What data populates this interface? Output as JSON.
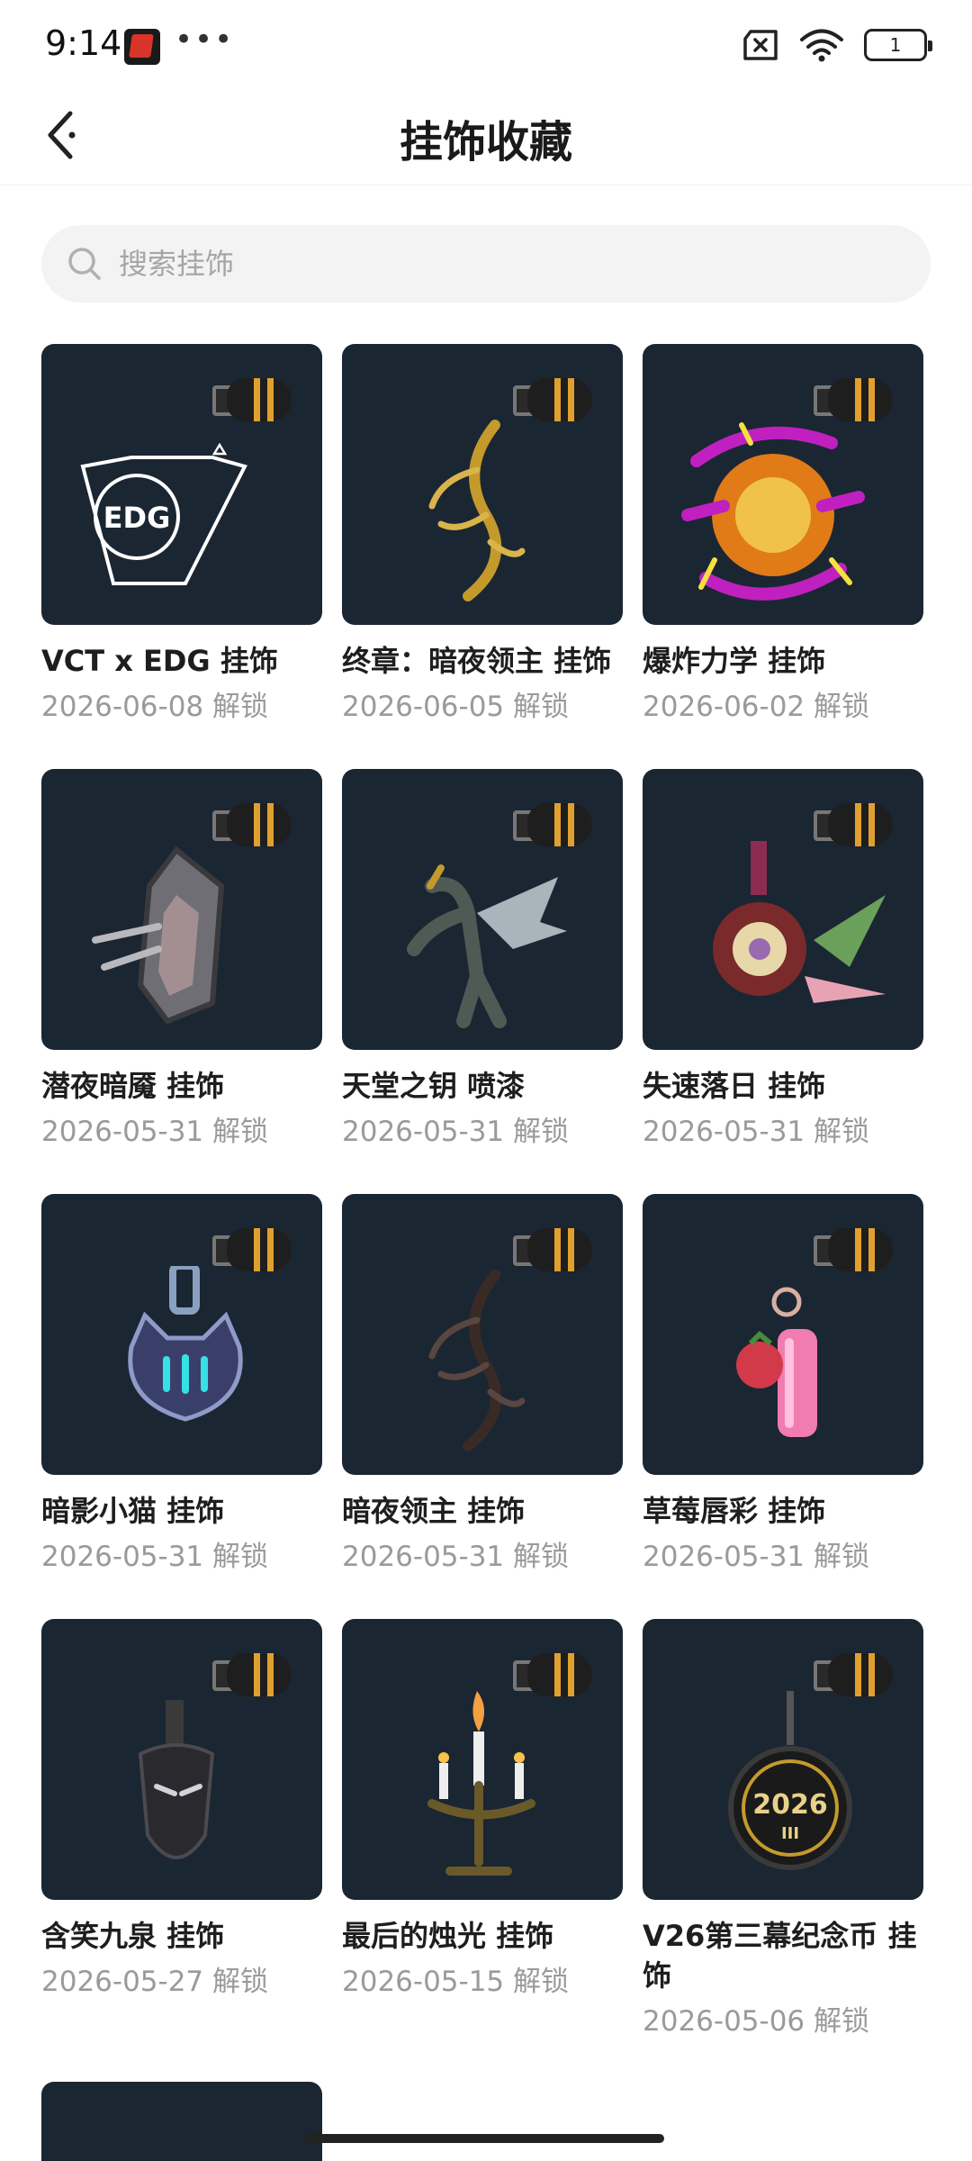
{
  "status_bar": {
    "time": "9:14",
    "dots": "•••",
    "battery": "1"
  },
  "nav": {
    "title": "挂饰收藏"
  },
  "search": {
    "placeholder": "搜索挂饰"
  },
  "items": [
    {
      "name": "VCT x EDG 挂饰",
      "date": "2026-06-08 解锁",
      "logo_text": "EDG"
    },
    {
      "name": "终章：暗夜领主 挂饰",
      "date": "2026-06-05 解锁"
    },
    {
      "name": "爆炸力学 挂饰",
      "date": "2026-06-02 解锁"
    },
    {
      "name": "潜夜暗魇 挂饰",
      "date": "2026-05-31 解锁"
    },
    {
      "name": "天堂之钥 喷漆",
      "date": "2026-05-31 解锁"
    },
    {
      "name": "失速落日 挂饰",
      "date": "2026-05-31 解锁"
    },
    {
      "name": "暗影小猫 挂饰",
      "date": "2026-05-31 解锁"
    },
    {
      "name": "暗夜领主 挂饰",
      "date": "2026-05-31 解锁"
    },
    {
      "name": "草莓唇彩 挂饰",
      "date": "2026-05-31 解锁"
    },
    {
      "name": "含笑九泉 挂饰",
      "date": "2026-05-27 解锁"
    },
    {
      "name": "最后的烛光 挂饰",
      "date": "2026-05-15 解锁"
    },
    {
      "name": "V26第三幕纪念币 挂饰",
      "date": "2026-05-06 解锁",
      "coin_text": "2026",
      "coin_sub": "III"
    }
  ]
}
